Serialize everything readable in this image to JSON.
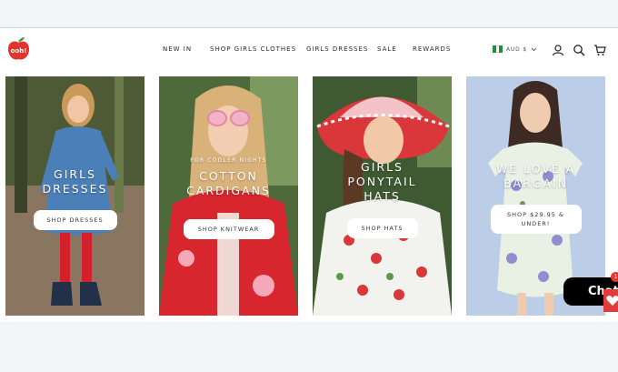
{
  "brand": {
    "logo_text": "ooh!",
    "colors": {
      "brand_red": "#e2342c",
      "dark": "#1f1f1f"
    }
  },
  "nav": {
    "items": [
      "NEW IN",
      "SHOP GIRLS CLOTHES",
      "GIRLS DRESSES",
      "SALE",
      "REWARDS"
    ]
  },
  "currency": {
    "label": "AUD $",
    "flag": "nigeria-flag-icon"
  },
  "icons": [
    "account-icon",
    "search-icon",
    "cart-icon"
  ],
  "cards": [
    {
      "kicker": "",
      "title": "GIRLS\nDRESSES",
      "button": "SHOP DRESSES"
    },
    {
      "kicker": "FOR COOLER NIGHTS",
      "title": "COTTON\nCARDIGANS",
      "button": "SHOP KNITWEAR"
    },
    {
      "kicker": "",
      "title": "GIRLS\nPONYTAIL\nHATS",
      "button": "SHOP HATS"
    },
    {
      "kicker": "",
      "title": "WE LOVE A\nBARGAIN",
      "button": "SHOP $29.95 &\nUNDER!"
    }
  ],
  "chat": {
    "label": "Chat",
    "badge": "1"
  }
}
